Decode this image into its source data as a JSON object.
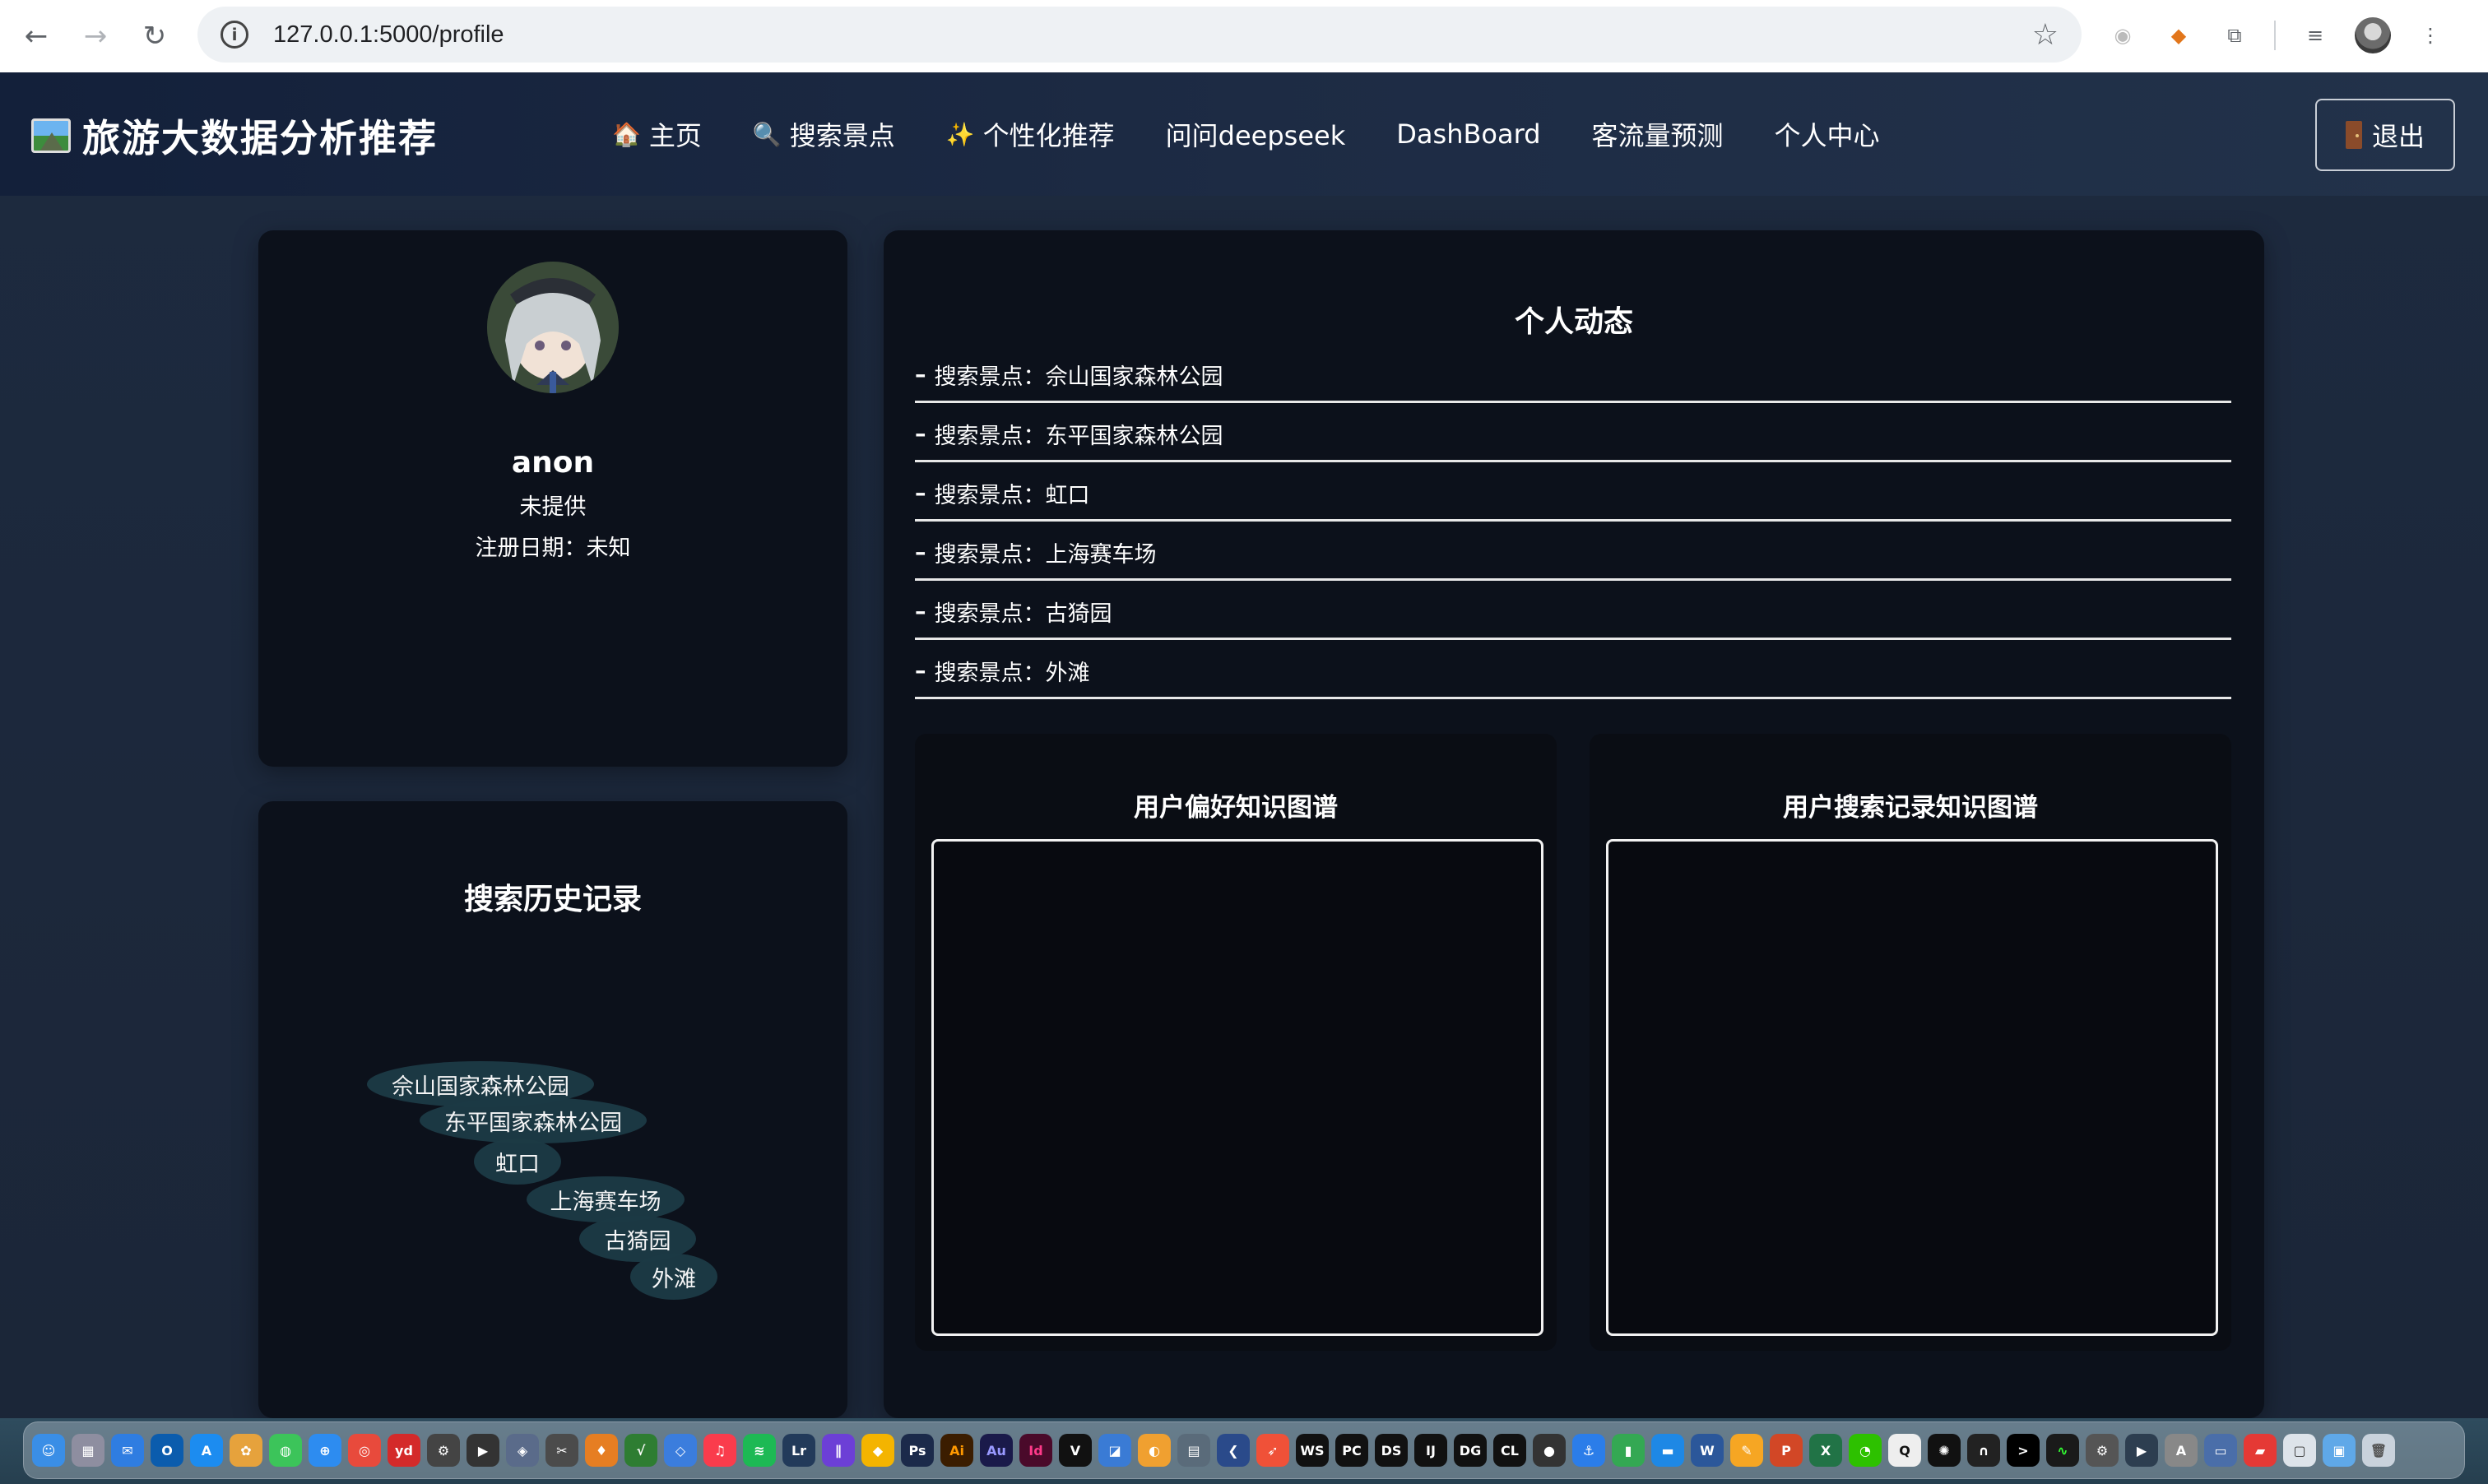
{
  "browser": {
    "url": "127.0.0.1:5000/profile",
    "back_glyph": "←",
    "forward_glyph": "→",
    "reload_glyph": "↻",
    "site_info_glyph": "i",
    "star_glyph": "☆"
  },
  "header": {
    "brand": "旅游大数据分析推荐",
    "menu": [
      {
        "icon": "🏠",
        "label": "主页"
      },
      {
        "icon": "🔍",
        "label": "搜索景点"
      },
      {
        "icon": "✨",
        "label": "个性化推荐"
      },
      {
        "icon": "",
        "label": "问问deepseek"
      },
      {
        "icon": "",
        "label": "DashBoard"
      },
      {
        "icon": "",
        "label": "客流量预测"
      },
      {
        "icon": "",
        "label": "个人中心"
      }
    ],
    "logout_label": "退出"
  },
  "profile": {
    "username": "anon",
    "email": "未提供",
    "register_date": "注册日期：未知"
  },
  "history": {
    "title": "搜索历史记录",
    "items": [
      "佘山国家森林公园",
      "东平国家森林公园",
      "虹口",
      "上海赛车场",
      "古猗园",
      "外滩"
    ]
  },
  "activity": {
    "title": "个人动态",
    "items": [
      "搜索景点：佘山国家森林公园",
      "搜索景点：东平国家森林公园",
      "搜索景点：虹口",
      "搜索景点：上海赛车场",
      "搜索景点：古猗园",
      "搜索景点：外滩"
    ],
    "dash": "–"
  },
  "graphs": {
    "preference_title": "用户偏好知识图谱",
    "search_title": "用户搜索记录知识图谱"
  },
  "colors": {
    "card_bg": "#0c111b",
    "page_bg": "#1b2638",
    "bubble": "#1c3a45"
  }
}
